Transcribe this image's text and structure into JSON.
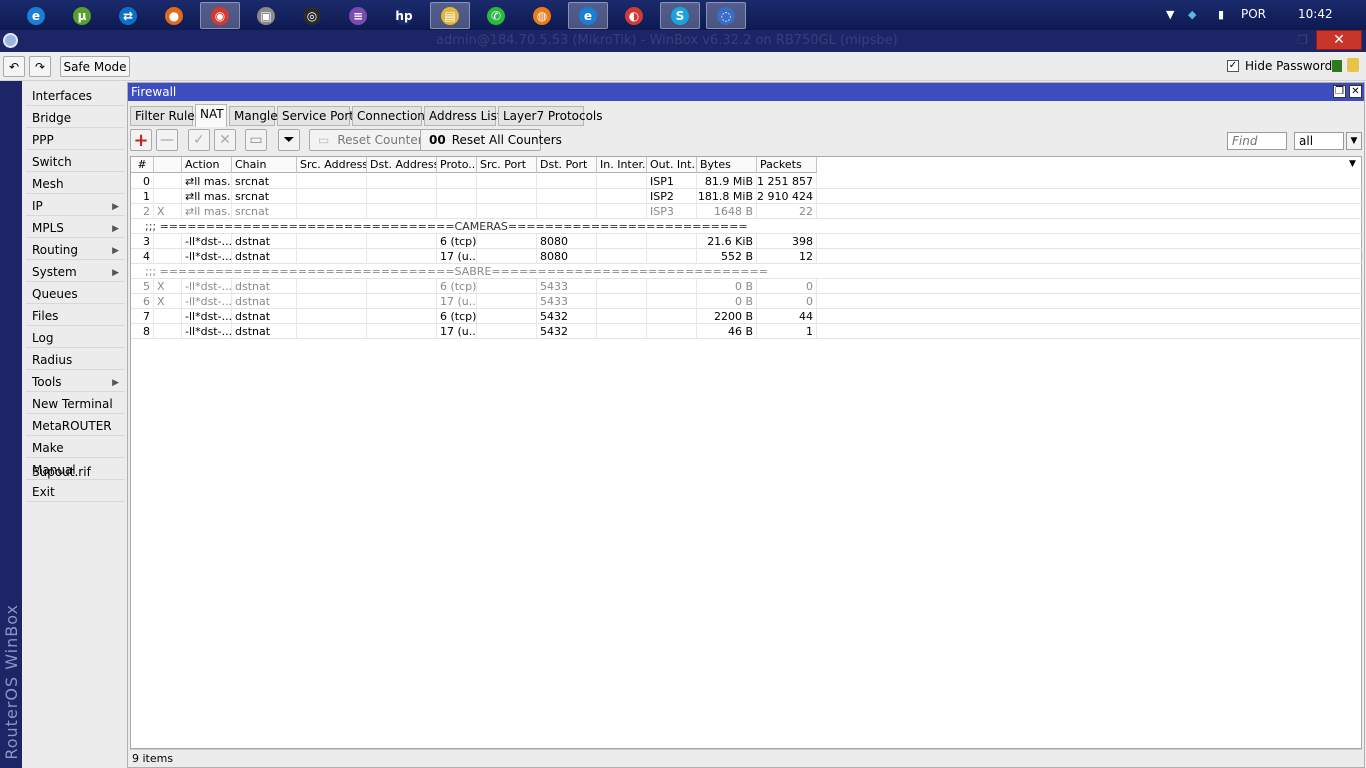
{
  "taskbar": {
    "apps": [
      {
        "icon": "ie-icon",
        "glyph": "e",
        "color": "#1a7fd4",
        "active": false
      },
      {
        "icon": "utorrent-icon",
        "glyph": "µ",
        "color": "#5aa02c",
        "active": false
      },
      {
        "icon": "teamviewer-icon",
        "glyph": "⇄",
        "color": "#0e6fc7",
        "active": false
      },
      {
        "icon": "firefox-icon",
        "glyph": "●",
        "color": "#e06a1b",
        "active": false
      },
      {
        "icon": "chrome-icon",
        "glyph": "◉",
        "color": "#d6392f",
        "active": true
      },
      {
        "icon": "cam-app-icon",
        "glyph": "▣",
        "color": "#8a8a8a",
        "active": false
      },
      {
        "icon": "obs-icon",
        "glyph": "◎",
        "color": "#2b2b2b",
        "active": false
      },
      {
        "icon": "onenote-icon",
        "glyph": "≡",
        "color": "#7a4ab0",
        "active": false
      },
      {
        "icon": "hp-icon",
        "glyph": "hp",
        "color": "#1b2a6b",
        "active": false
      },
      {
        "icon": "explorer-icon",
        "glyph": "▤",
        "color": "#e1b43a",
        "active": true
      },
      {
        "icon": "whatsapp-icon",
        "glyph": "✆",
        "color": "#2bb641",
        "active": false
      },
      {
        "icon": "avast-icon",
        "glyph": "◍",
        "color": "#ef7a1a",
        "active": false
      },
      {
        "icon": "ie-icon",
        "glyph": "e",
        "color": "#1a7fd4",
        "active": true
      },
      {
        "icon": "app-red-icon",
        "glyph": "◐",
        "color": "#d23a3a",
        "active": false
      },
      {
        "icon": "skype-icon",
        "glyph": "S",
        "color": "#1aa3e0",
        "active": true
      },
      {
        "icon": "winbox-icon",
        "glyph": "◌",
        "color": "#3b6dc7",
        "active": true
      }
    ],
    "language": "POR",
    "clock": "10:42"
  },
  "window": {
    "title": "admin@184.70.5.53 (MikroTik) - WinBox v6.32.2 on RB750GL (mipsbe)"
  },
  "toolbar": {
    "safe_mode": "Safe Mode",
    "hide_passwords_label": "Hide Passwords",
    "hide_passwords_checked": "✓"
  },
  "sidebar": {
    "brand": "RouterOS WinBox",
    "items": [
      {
        "label": "Interfaces",
        "sub": false
      },
      {
        "label": "Bridge",
        "sub": false
      },
      {
        "label": "PPP",
        "sub": false
      },
      {
        "label": "Switch",
        "sub": false
      },
      {
        "label": "Mesh",
        "sub": false
      },
      {
        "label": "IP",
        "sub": true
      },
      {
        "label": "MPLS",
        "sub": true
      },
      {
        "label": "Routing",
        "sub": true
      },
      {
        "label": "System",
        "sub": true
      },
      {
        "label": "Queues",
        "sub": false
      },
      {
        "label": "Files",
        "sub": false
      },
      {
        "label": "Log",
        "sub": false
      },
      {
        "label": "Radius",
        "sub": false
      },
      {
        "label": "Tools",
        "sub": true
      },
      {
        "label": "New Terminal",
        "sub": false
      },
      {
        "label": "MetaROUTER",
        "sub": false
      },
      {
        "label": "Make Supout.rif",
        "sub": false
      },
      {
        "label": "Manual",
        "sub": false
      },
      {
        "label": "Exit",
        "sub": false
      }
    ]
  },
  "firewall": {
    "title": "Firewall",
    "tabs": [
      "Filter Rules",
      "NAT",
      "Mangle",
      "Service Ports",
      "Connections",
      "Address Lists",
      "Layer7 Protocols"
    ],
    "active_tab": 1,
    "reset_counters": "Reset Counters",
    "reset_all_counters": "Reset All Counters",
    "reset_all_prefix": "00",
    "find_placeholder": "Find",
    "filter_value": "all",
    "columns": [
      "#",
      "",
      "Action",
      "Chain",
      "Src. Address",
      "Dst. Address",
      "Proto...",
      "Src. Port",
      "Dst. Port",
      "In. Inter...",
      "Out. Int...",
      "Bytes",
      "Packets"
    ],
    "rows": [
      {
        "type": "rule",
        "num": "0",
        "flag": "",
        "action": "⇄ll mas...",
        "chain": "srcnat",
        "src": "",
        "dst": "",
        "proto": "",
        "sport": "",
        "dport": "",
        "in": "",
        "out": "ISP1",
        "bytes": "81.9 MiB",
        "packets": "1 251 857",
        "disabled": false
      },
      {
        "type": "rule",
        "num": "1",
        "flag": "",
        "action": "⇄ll mas...",
        "chain": "srcnat",
        "src": "",
        "dst": "",
        "proto": "",
        "sport": "",
        "dport": "",
        "in": "",
        "out": "ISP2",
        "bytes": "181.8 MiB",
        "packets": "2 910 424",
        "disabled": false
      },
      {
        "type": "rule",
        "num": "2",
        "flag": "X",
        "action": "⇄ll mas...",
        "chain": "srcnat",
        "src": "",
        "dst": "",
        "proto": "",
        "sport": "",
        "dport": "",
        "in": "",
        "out": "ISP3",
        "bytes": "1648 B",
        "packets": "22",
        "disabled": true
      },
      {
        "type": "comment",
        "text": ";;; ================================CAMERAS==========================",
        "disabled": false
      },
      {
        "type": "rule",
        "num": "3",
        "flag": "",
        "action": "-ll*dst-...",
        "chain": "dstnat",
        "src": "",
        "dst": "",
        "proto": "6 (tcp)",
        "sport": "",
        "dport": "8080",
        "in": "",
        "out": "",
        "bytes": "21.6 KiB",
        "packets": "398",
        "disabled": false
      },
      {
        "type": "rule",
        "num": "4",
        "flag": "",
        "action": "-ll*dst-...",
        "chain": "dstnat",
        "src": "",
        "dst": "",
        "proto": "17 (u...",
        "sport": "",
        "dport": "8080",
        "in": "",
        "out": "",
        "bytes": "552 B",
        "packets": "12",
        "disabled": false
      },
      {
        "type": "comment",
        "text": ";;; ================================SABRE==============================",
        "disabled": true
      },
      {
        "type": "rule",
        "num": "5",
        "flag": "X",
        "action": "-ll*dst-...",
        "chain": "dstnat",
        "src": "",
        "dst": "",
        "proto": "6 (tcp)",
        "sport": "",
        "dport": "5433",
        "in": "",
        "out": "",
        "bytes": "0 B",
        "packets": "0",
        "disabled": true
      },
      {
        "type": "rule",
        "num": "6",
        "flag": "X",
        "action": "-ll*dst-...",
        "chain": "dstnat",
        "src": "",
        "dst": "",
        "proto": "17 (u...",
        "sport": "",
        "dport": "5433",
        "in": "",
        "out": "",
        "bytes": "0 B",
        "packets": "0",
        "disabled": true
      },
      {
        "type": "rule",
        "num": "7",
        "flag": "",
        "action": "-ll*dst-...",
        "chain": "dstnat",
        "src": "",
        "dst": "",
        "proto": "6 (tcp)",
        "sport": "",
        "dport": "5432",
        "in": "",
        "out": "",
        "bytes": "2200 B",
        "packets": "44",
        "disabled": false
      },
      {
        "type": "rule",
        "num": "8",
        "flag": "",
        "action": "-ll*dst-...",
        "chain": "dstnat",
        "src": "",
        "dst": "",
        "proto": "17 (u...",
        "sport": "",
        "dport": "5432",
        "in": "",
        "out": "",
        "bytes": "46 B",
        "packets": "1",
        "disabled": false
      }
    ],
    "status": "9 items"
  }
}
